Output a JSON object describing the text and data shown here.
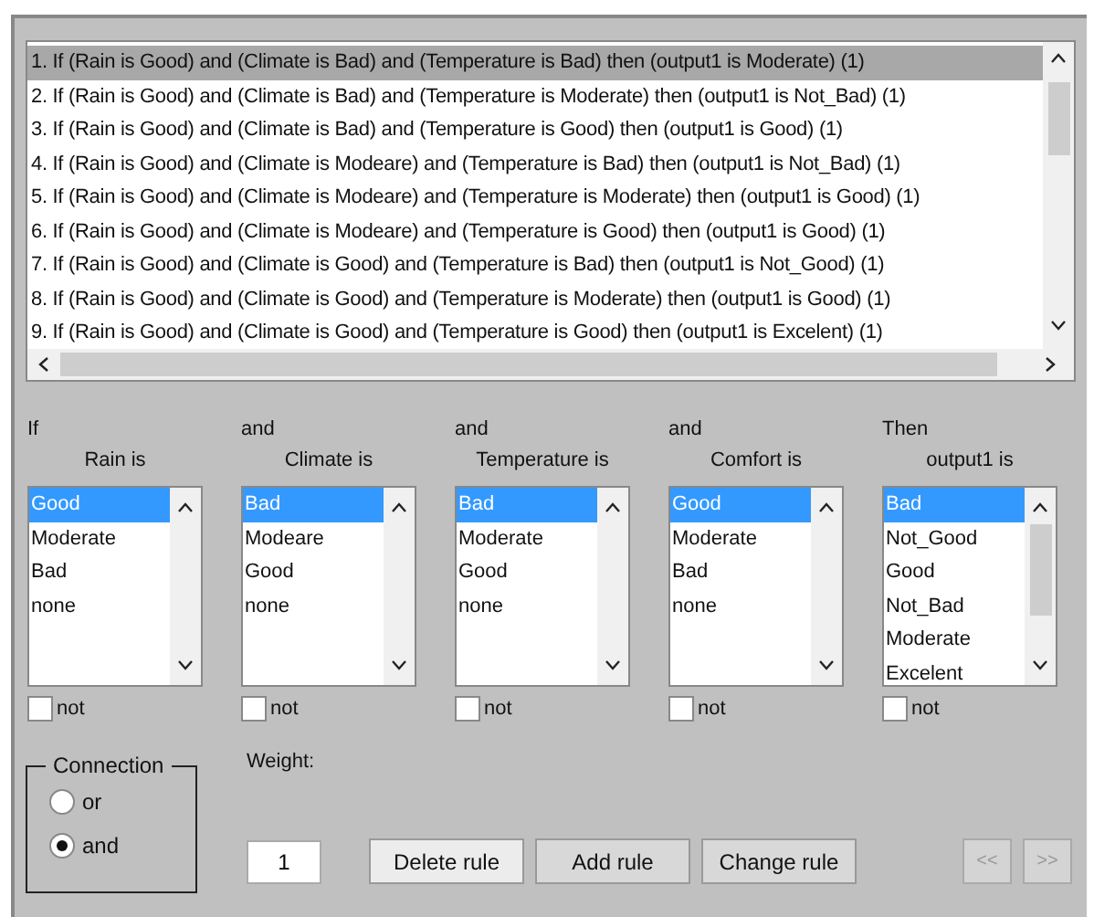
{
  "rules": [
    {
      "text": "1. If (Rain is Good) and (Climate is Bad) and (Temperature is Bad) then (output1 is Moderate) (1)",
      "selected": true
    },
    {
      "text": "2. If (Rain is Good) and (Climate is Bad) and (Temperature is Moderate) then (output1 is Not_Bad) (1)",
      "selected": false
    },
    {
      "text": "3. If (Rain is Good) and (Climate is Bad) and (Temperature is Good) then (output1 is Good) (1)",
      "selected": false
    },
    {
      "text": "4. If (Rain is Good) and (Climate is Modeare) and (Temperature is Bad) then (output1 is Not_Bad) (1)",
      "selected": false
    },
    {
      "text": "5. If (Rain is Good) and (Climate is Modeare) and (Temperature is Moderate) then (output1 is Good) (1)",
      "selected": false
    },
    {
      "text": "6. If (Rain is Good) and (Climate is Modeare) and (Temperature is Good) then (output1 is Good) (1)",
      "selected": false
    },
    {
      "text": "7. If (Rain is Good) and (Climate is Good) and (Temperature is Bad) then (output1 is Not_Good) (1)",
      "selected": false
    },
    {
      "text": "8. If (Rain is Good) and (Climate is Good) and (Temperature is Moderate) then (output1 is Good) (1)",
      "selected": false
    },
    {
      "text": "9. If (Rain is Good) and (Climate is Good) and (Temperature is Good) then (output1 is Excelent) (1)",
      "selected": false
    }
  ],
  "variables": [
    {
      "connector": "If",
      "title": "Rain is",
      "options": [
        {
          "label": "Good",
          "selected": true
        },
        {
          "label": "Moderate",
          "selected": false
        },
        {
          "label": "Bad",
          "selected": false
        },
        {
          "label": "none",
          "selected": false
        }
      ],
      "not_label": "not",
      "not_checked": false
    },
    {
      "connector": "and",
      "title": "Climate is",
      "options": [
        {
          "label": "Bad",
          "selected": true
        },
        {
          "label": "Modeare",
          "selected": false
        },
        {
          "label": "Good",
          "selected": false
        },
        {
          "label": "none",
          "selected": false
        }
      ],
      "not_label": "not",
      "not_checked": false
    },
    {
      "connector": "and",
      "title": "Temperature is",
      "options": [
        {
          "label": "Bad",
          "selected": true
        },
        {
          "label": "Moderate",
          "selected": false
        },
        {
          "label": "Good",
          "selected": false
        },
        {
          "label": "none",
          "selected": false
        }
      ],
      "not_label": "not",
      "not_checked": false
    },
    {
      "connector": "and",
      "title": "Comfort is",
      "options": [
        {
          "label": "Good",
          "selected": true
        },
        {
          "label": "Moderate",
          "selected": false
        },
        {
          "label": "Bad",
          "selected": false
        },
        {
          "label": "none",
          "selected": false
        }
      ],
      "not_label": "not",
      "not_checked": false
    },
    {
      "connector": "Then",
      "title": "output1 is",
      "options": [
        {
          "label": "Bad",
          "selected": true
        },
        {
          "label": "Not_Good",
          "selected": false
        },
        {
          "label": "Good",
          "selected": false
        },
        {
          "label": "Not_Bad",
          "selected": false
        },
        {
          "label": "Moderate",
          "selected": false
        },
        {
          "label": "Excelent",
          "selected": false
        }
      ],
      "not_label": "not",
      "not_checked": false
    }
  ],
  "connection": {
    "title": "Connection",
    "options": [
      {
        "label": "or",
        "selected": false
      },
      {
        "label": "and",
        "selected": true
      }
    ]
  },
  "weight": {
    "label": "Weight:",
    "value": "1"
  },
  "buttons": [
    {
      "label": "Delete rule",
      "disabled": false
    },
    {
      "label": "Add rule",
      "disabled": false
    },
    {
      "label": "Change rule",
      "disabled": false
    }
  ],
  "nav_buttons": [
    {
      "label": "<<",
      "disabled": true
    },
    {
      "label": ">>",
      "disabled": true
    }
  ]
}
